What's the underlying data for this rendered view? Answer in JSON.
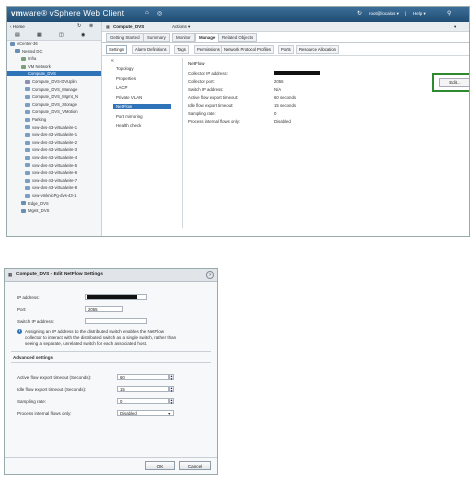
{
  "top": {
    "brand_vm": "vm",
    "brand_rest": "ware® vSphere Web Client",
    "home_icon": "home-icon",
    "user": "root@localos ▾",
    "separator": "|",
    "help": "Help ▾",
    "navigator": {
      "home_label": "‹ Home",
      "tree": [
        "vCenter-36",
        "Nested DC",
        "Infra",
        "VM Network",
        "Compute_DVS",
        "Compute_DVS-DVUplin",
        "Compute_DVS_Manage",
        "Compute_DVS_Mgmt_N",
        "Compute_DVS_Storage",
        "Compute_DVS_VMotion",
        "Parking",
        "vxw-dvs-43-virtualwire-1",
        "vxw-dvs-43-virtualwire-1",
        "vxw-dvs-43-virtualwire-2",
        "vxw-dvs-43-virtualwire-3",
        "vxw-dvs-43-virtualwire-4",
        "vxw-dvs-43-virtualwire-5",
        "vxw-dvs-43-virtualwire-6",
        "vxw-dvs-43-virtualwire-7",
        "vxw-dvs-43-virtualwire-8",
        "vxw-vmknicPg-dvs-43-1",
        "Edge_DVS",
        "Mgmt_DVS"
      ]
    },
    "object": {
      "title": "Compute_DVS",
      "actions": "Actions ▾",
      "tabs": [
        "Getting Started",
        "Summary",
        "Monitor",
        "Manage",
        "Related Objects"
      ],
      "active_tab": "Manage",
      "subtabs": [
        "Settings",
        "Alarm Definitions",
        "Tags",
        "Permissions",
        "Network Protocol Profiles",
        "Ports",
        "Resource Allocation"
      ],
      "active_subtab": "Settings",
      "collapse_icon": "«",
      "side_items": [
        "Topology",
        "Properties",
        "LACP",
        "Private VLAN",
        "NetFlow",
        "Port mirroring",
        "Health check"
      ],
      "active_side": "NetFlow",
      "section_title": "NetFlow",
      "edit_label": "Edit...",
      "props": [
        {
          "label": "Collector IP address:",
          "value": ""
        },
        {
          "label": "Collector port:",
          "value": "2055"
        },
        {
          "label": "Switch IP address:",
          "value": "N/A"
        },
        {
          "label": "Active flow export timeout:",
          "value": "60 seconds"
        },
        {
          "label": "Idle flow export timeout:",
          "value": "15 seconds"
        },
        {
          "label": "Sampling rate:",
          "value": "0"
        },
        {
          "label": "Process internal flows only:",
          "value": "Disabled"
        }
      ]
    }
  },
  "dialog": {
    "title": "Compute_DVS - Edit NetFlow Settings",
    "help_icon": "?",
    "ip_label": "IP address:",
    "ip_value": "",
    "port_label": "Port:",
    "port_value": "2055",
    "switch_ip_label": "Switch IP address:",
    "switch_ip_value": "",
    "info_text_1": "Assigning an IP address to the distributed switch enables the NetFlow",
    "info_text_2": "collector to interact with the distributed switch as a single switch, rather than",
    "info_text_3": "seeing a separate, unrelated switch for each associated host.",
    "advanced_label": "Advanced settings",
    "active_timeout_label": "Active flow export timeout (Seconds):",
    "active_timeout_value": "60",
    "idle_timeout_label": "Idle flow export timeout (Seconds):",
    "idle_timeout_value": "15",
    "sampling_label": "Sampling rate:",
    "sampling_value": "0",
    "internal_label": "Process internal flows only:",
    "internal_value": "Disabled",
    "ok_label": "OK",
    "cancel_label": "Cancel"
  }
}
